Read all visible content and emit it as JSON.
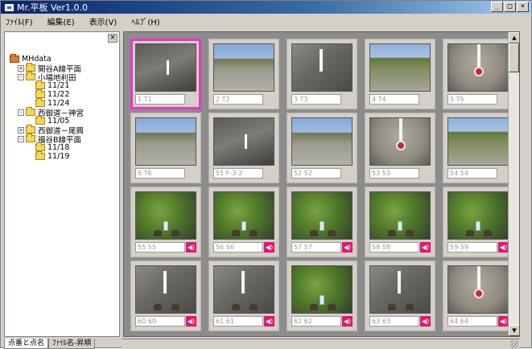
{
  "window": {
    "title": "Mr.平板 Ver1.0.0",
    "buttons": {
      "minimize": "_",
      "maximize": "□",
      "close": "×"
    }
  },
  "menu": {
    "items": [
      "ﾌｧｲﾙ(F)",
      "編集(E)",
      "表示(V)",
      "ﾍﾙﾌﾟ(H)"
    ]
  },
  "sidebar": {
    "close_label": "×",
    "tree": [
      {
        "label": "MHdata",
        "expander": "",
        "root": true
      },
      {
        "label": "開谷A線平面",
        "expander": "+"
      },
      {
        "label": "小場地利田",
        "expander": "-"
      },
      {
        "label": "11/21",
        "expander": ""
      },
      {
        "label": "11/22",
        "expander": ""
      },
      {
        "label": "11/24",
        "expander": ""
      },
      {
        "label": "西御道－神宮",
        "expander": "-"
      },
      {
        "label": "11/05",
        "expander": ""
      },
      {
        "label": "西御道－尾興",
        "expander": "+"
      },
      {
        "label": "福谷B線平面",
        "expander": "-"
      },
      {
        "label": "11/18",
        "expander": ""
      },
      {
        "label": "11/19",
        "expander": ""
      }
    ]
  },
  "tabs": [
    "点番と点名",
    "ﾌｧｲﾙ名-昇順"
  ],
  "gallery": {
    "thumbnails": [
      {
        "caption": "1 T1",
        "scene": "concrete",
        "has_audio": false,
        "selected": true
      },
      {
        "caption": "2 T2",
        "scene": "road",
        "has_audio": false,
        "selected": false
      },
      {
        "caption": "3 T3",
        "scene": "stone",
        "has_audio": false,
        "selected": false
      },
      {
        "caption": "4 T4",
        "scene": "rural",
        "has_audio": false,
        "selected": false
      },
      {
        "caption": "5 T5",
        "scene": "gravel",
        "has_audio": false,
        "selected": false
      },
      {
        "caption": "6 T6",
        "scene": "road",
        "has_audio": false,
        "selected": false
      },
      {
        "caption": "51 F-3-2",
        "scene": "concrete",
        "has_audio": false,
        "selected": false
      },
      {
        "caption": "52 52",
        "scene": "road",
        "has_audio": false,
        "selected": false
      },
      {
        "caption": "53 53",
        "scene": "gravel",
        "has_audio": false,
        "selected": false
      },
      {
        "caption": "54 54",
        "scene": "rural",
        "has_audio": false,
        "selected": false
      },
      {
        "caption": "55 55",
        "scene": "grass",
        "has_audio": true,
        "selected": false
      },
      {
        "caption": "56 56",
        "scene": "grass",
        "has_audio": true,
        "selected": false
      },
      {
        "caption": "57 57",
        "scene": "grass",
        "has_audio": true,
        "selected": false
      },
      {
        "caption": "58 58",
        "scene": "grass",
        "has_audio": true,
        "selected": false
      },
      {
        "caption": "59 59",
        "scene": "grass",
        "has_audio": true,
        "selected": false
      },
      {
        "caption": "60 60",
        "scene": "stone",
        "has_audio": true,
        "selected": false
      },
      {
        "caption": "61 61",
        "scene": "stone",
        "has_audio": true,
        "selected": false
      },
      {
        "caption": "62 62",
        "scene": "grass",
        "has_audio": true,
        "selected": false
      },
      {
        "caption": "63 63",
        "scene": "stone",
        "has_audio": true,
        "selected": false
      },
      {
        "caption": "64 64",
        "scene": "gravel",
        "has_audio": true,
        "selected": false
      }
    ],
    "audio_icon": "speaker-icon",
    "selection_color": "#ee33cc"
  },
  "scrollbar": {
    "up": "▲",
    "down": "▼"
  }
}
